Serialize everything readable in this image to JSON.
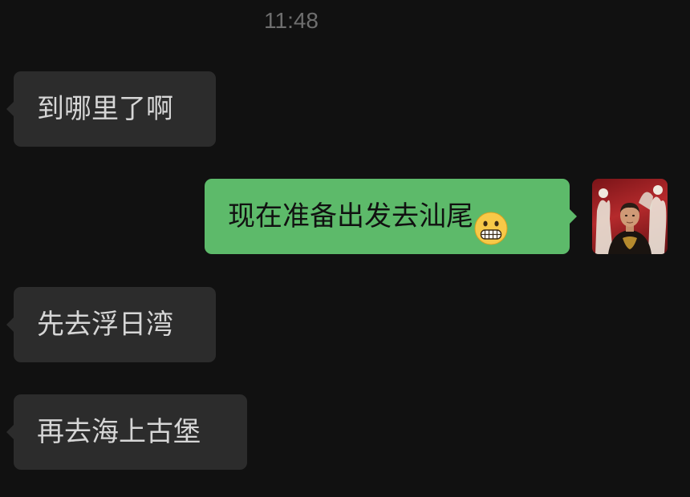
{
  "status": {
    "time": "11:48"
  },
  "messages": [
    {
      "direction": "incoming",
      "text": "到哪里了啊"
    },
    {
      "direction": "outgoing",
      "text": "现在准备出发去汕尾",
      "emoji": "grimacing-face-emoji"
    },
    {
      "direction": "incoming",
      "text": "先去浮日湾"
    },
    {
      "direction": "incoming",
      "text": "再去海上古堡"
    }
  ],
  "colors": {
    "background": "#111111",
    "incoming_bubble": "#2c2c2c",
    "outgoing_bubble": "#5dba6a",
    "timestamp": "#6e6e6e"
  },
  "avatar": {
    "icon": "user-avatar-photo"
  }
}
